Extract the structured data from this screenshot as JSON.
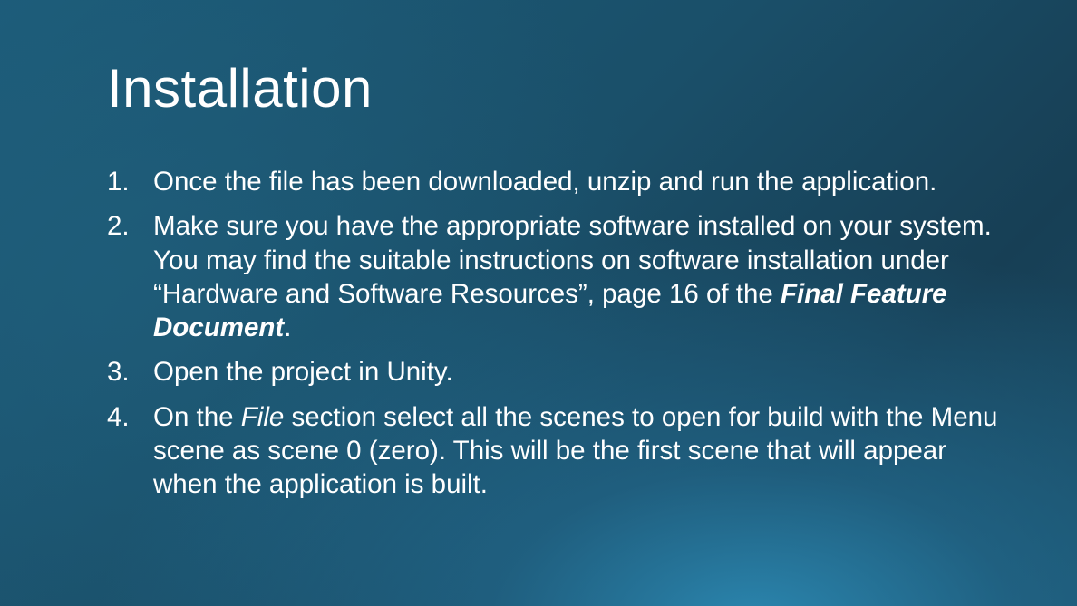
{
  "slide": {
    "title": "Installation",
    "steps": [
      {
        "number": "1.",
        "text": "Once the file has been downloaded, unzip and run the application."
      },
      {
        "number": "2.",
        "text_before": "Make sure you have the appropriate software installed on your system. You may find the suitable instructions on software installation under “Hardware and Software Resources”, page 16 of the ",
        "emphasis": "Final Feature Document",
        "text_after": "."
      },
      {
        "number": "3.",
        "text": "Open the project in Unity."
      },
      {
        "number": "4.",
        "text_before": "On the ",
        "emphasis": "File",
        "text_after": " section select all the scenes to open for build with the Menu scene as scene 0 (zero). This will be the first scene that will appear when the application is built."
      }
    ]
  }
}
